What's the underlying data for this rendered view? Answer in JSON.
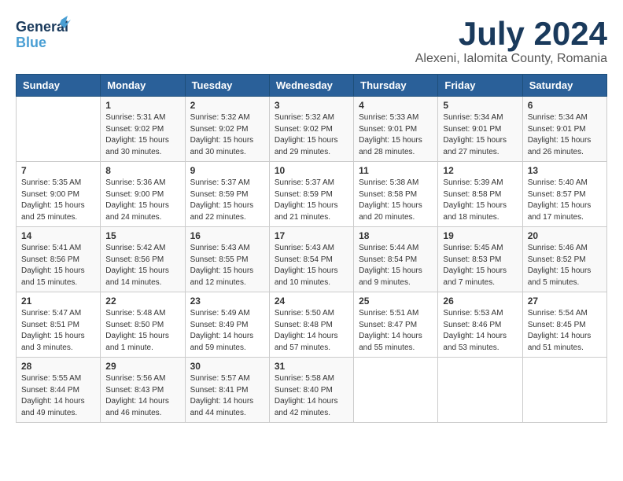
{
  "header": {
    "logo_general": "General",
    "logo_blue": "Blue",
    "month_year": "July 2024",
    "location": "Alexeni, Ialomita County, Romania"
  },
  "days_of_week": [
    "Sunday",
    "Monday",
    "Tuesday",
    "Wednesday",
    "Thursday",
    "Friday",
    "Saturday"
  ],
  "weeks": [
    [
      {
        "day": "",
        "content": ""
      },
      {
        "day": "1",
        "content": "Sunrise: 5:31 AM\nSunset: 9:02 PM\nDaylight: 15 hours\nand 30 minutes."
      },
      {
        "day": "2",
        "content": "Sunrise: 5:32 AM\nSunset: 9:02 PM\nDaylight: 15 hours\nand 30 minutes."
      },
      {
        "day": "3",
        "content": "Sunrise: 5:32 AM\nSunset: 9:02 PM\nDaylight: 15 hours\nand 29 minutes."
      },
      {
        "day": "4",
        "content": "Sunrise: 5:33 AM\nSunset: 9:01 PM\nDaylight: 15 hours\nand 28 minutes."
      },
      {
        "day": "5",
        "content": "Sunrise: 5:34 AM\nSunset: 9:01 PM\nDaylight: 15 hours\nand 27 minutes."
      },
      {
        "day": "6",
        "content": "Sunrise: 5:34 AM\nSunset: 9:01 PM\nDaylight: 15 hours\nand 26 minutes."
      }
    ],
    [
      {
        "day": "7",
        "content": "Sunrise: 5:35 AM\nSunset: 9:00 PM\nDaylight: 15 hours\nand 25 minutes."
      },
      {
        "day": "8",
        "content": "Sunrise: 5:36 AM\nSunset: 9:00 PM\nDaylight: 15 hours\nand 24 minutes."
      },
      {
        "day": "9",
        "content": "Sunrise: 5:37 AM\nSunset: 8:59 PM\nDaylight: 15 hours\nand 22 minutes."
      },
      {
        "day": "10",
        "content": "Sunrise: 5:37 AM\nSunset: 8:59 PM\nDaylight: 15 hours\nand 21 minutes."
      },
      {
        "day": "11",
        "content": "Sunrise: 5:38 AM\nSunset: 8:58 PM\nDaylight: 15 hours\nand 20 minutes."
      },
      {
        "day": "12",
        "content": "Sunrise: 5:39 AM\nSunset: 8:58 PM\nDaylight: 15 hours\nand 18 minutes."
      },
      {
        "day": "13",
        "content": "Sunrise: 5:40 AM\nSunset: 8:57 PM\nDaylight: 15 hours\nand 17 minutes."
      }
    ],
    [
      {
        "day": "14",
        "content": "Sunrise: 5:41 AM\nSunset: 8:56 PM\nDaylight: 15 hours\nand 15 minutes."
      },
      {
        "day": "15",
        "content": "Sunrise: 5:42 AM\nSunset: 8:56 PM\nDaylight: 15 hours\nand 14 minutes."
      },
      {
        "day": "16",
        "content": "Sunrise: 5:43 AM\nSunset: 8:55 PM\nDaylight: 15 hours\nand 12 minutes."
      },
      {
        "day": "17",
        "content": "Sunrise: 5:43 AM\nSunset: 8:54 PM\nDaylight: 15 hours\nand 10 minutes."
      },
      {
        "day": "18",
        "content": "Sunrise: 5:44 AM\nSunset: 8:54 PM\nDaylight: 15 hours\nand 9 minutes."
      },
      {
        "day": "19",
        "content": "Sunrise: 5:45 AM\nSunset: 8:53 PM\nDaylight: 15 hours\nand 7 minutes."
      },
      {
        "day": "20",
        "content": "Sunrise: 5:46 AM\nSunset: 8:52 PM\nDaylight: 15 hours\nand 5 minutes."
      }
    ],
    [
      {
        "day": "21",
        "content": "Sunrise: 5:47 AM\nSunset: 8:51 PM\nDaylight: 15 hours\nand 3 minutes."
      },
      {
        "day": "22",
        "content": "Sunrise: 5:48 AM\nSunset: 8:50 PM\nDaylight: 15 hours\nand 1 minute."
      },
      {
        "day": "23",
        "content": "Sunrise: 5:49 AM\nSunset: 8:49 PM\nDaylight: 14 hours\nand 59 minutes."
      },
      {
        "day": "24",
        "content": "Sunrise: 5:50 AM\nSunset: 8:48 PM\nDaylight: 14 hours\nand 57 minutes."
      },
      {
        "day": "25",
        "content": "Sunrise: 5:51 AM\nSunset: 8:47 PM\nDaylight: 14 hours\nand 55 minutes."
      },
      {
        "day": "26",
        "content": "Sunrise: 5:53 AM\nSunset: 8:46 PM\nDaylight: 14 hours\nand 53 minutes."
      },
      {
        "day": "27",
        "content": "Sunrise: 5:54 AM\nSunset: 8:45 PM\nDaylight: 14 hours\nand 51 minutes."
      }
    ],
    [
      {
        "day": "28",
        "content": "Sunrise: 5:55 AM\nSunset: 8:44 PM\nDaylight: 14 hours\nand 49 minutes."
      },
      {
        "day": "29",
        "content": "Sunrise: 5:56 AM\nSunset: 8:43 PM\nDaylight: 14 hours\nand 46 minutes."
      },
      {
        "day": "30",
        "content": "Sunrise: 5:57 AM\nSunset: 8:41 PM\nDaylight: 14 hours\nand 44 minutes."
      },
      {
        "day": "31",
        "content": "Sunrise: 5:58 AM\nSunset: 8:40 PM\nDaylight: 14 hours\nand 42 minutes."
      },
      {
        "day": "",
        "content": ""
      },
      {
        "day": "",
        "content": ""
      },
      {
        "day": "",
        "content": ""
      }
    ]
  ]
}
